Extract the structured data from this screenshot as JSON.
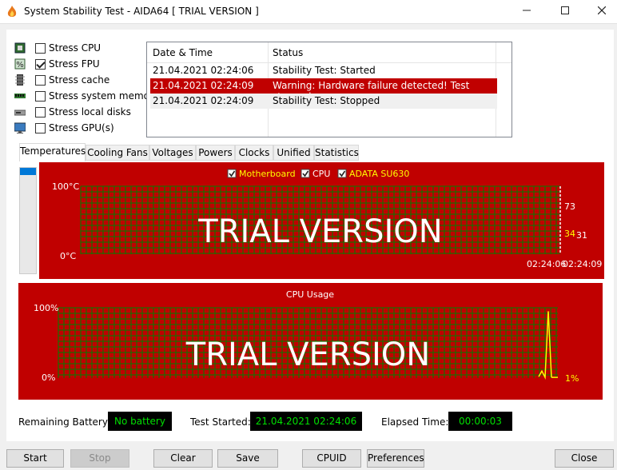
{
  "window": {
    "title": "System Stability Test - AIDA64  [ TRIAL VERSION ]"
  },
  "stress_options": [
    {
      "label": "Stress CPU",
      "checked": false,
      "icon": "cpu-chip-icon"
    },
    {
      "label": "Stress FPU",
      "checked": true,
      "icon": "fpu-percent-icon"
    },
    {
      "label": "Stress cache",
      "checked": false,
      "icon": "cache-chip-icon"
    },
    {
      "label": "Stress system memory",
      "checked": false,
      "icon": "memory-stick-icon"
    },
    {
      "label": "Stress local disks",
      "checked": false,
      "icon": "disk-drive-icon"
    },
    {
      "label": "Stress GPU(s)",
      "checked": false,
      "icon": "monitor-gpu-icon"
    }
  ],
  "log": {
    "headers": [
      "Date & Time",
      "Status"
    ],
    "rows": [
      {
        "time": "21.04.2021 02:24:06",
        "status": "Stability Test: Started",
        "style": "normal"
      },
      {
        "time": "21.04.2021 02:24:09",
        "status": "Warning: Hardware failure detected! Test stopped",
        "style": "alert"
      },
      {
        "time": "21.04.2021 02:24:09",
        "status": "Stability Test: Stopped",
        "style": "alt"
      }
    ]
  },
  "tabs": [
    "Temperatures",
    "Cooling Fans",
    "Voltages",
    "Powers",
    "Clocks",
    "Unified",
    "Statistics"
  ],
  "active_tab": "Temperatures",
  "temp_chart": {
    "legend": [
      {
        "label": "Motherboard",
        "checked": true,
        "color": "#ffff00"
      },
      {
        "label": "CPU",
        "checked": true,
        "color": "#ffffff"
      },
      {
        "label": "ADATA SU630",
        "checked": true,
        "color": "#ffff00"
      }
    ],
    "y_max_label": "100°C",
    "y_min_label": "0°C",
    "watermark": "TRIAL VERSION",
    "values": [
      {
        "value": "73",
        "color": "#ffffff"
      },
      {
        "value": "34",
        "color": "#ffff00"
      },
      {
        "value": "31",
        "color": "#ffffff"
      }
    ],
    "time_labels": [
      "02:24:06",
      "02:24:09"
    ]
  },
  "cpu_chart": {
    "title": "CPU Usage",
    "y_max_label": "100%",
    "y_min_label": "0%",
    "watermark": "TRIAL VERSION",
    "current_value": "1%",
    "series": [
      2,
      10,
      1,
      95,
      1
    ]
  },
  "status_bar": {
    "battery_label": "Remaining Battery:",
    "battery_value": "No battery",
    "started_label": "Test Started:",
    "started_value": "21.04.2021 02:24:06",
    "elapsed_label": "Elapsed Time:",
    "elapsed_value": "00:00:03"
  },
  "buttons": {
    "start": "Start",
    "stop": "Stop",
    "clear": "Clear",
    "save": "Save",
    "cpuid": "CPUID",
    "preferences": "Preferences",
    "close": "Close"
  },
  "colors": {
    "chart_bg": "#c00000",
    "grid": "#008000",
    "accent_blue": "#0078d7",
    "status_text": "#00e000"
  }
}
